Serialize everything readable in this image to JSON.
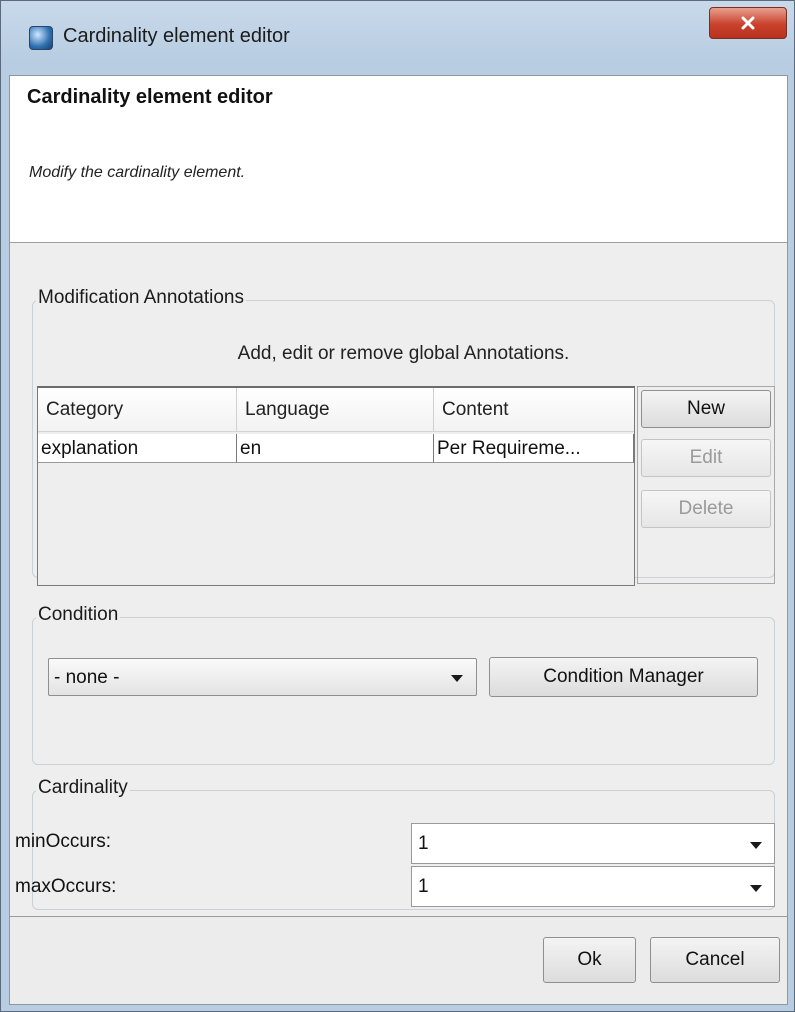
{
  "window": {
    "title": "Cardinality element editor",
    "icon": "globe-icon",
    "close_icon": "close-icon",
    "close_color": "#c9412b"
  },
  "header": {
    "title": "Cardinality element editor",
    "description": "Modify the cardinality element."
  },
  "annotations": {
    "legend": "Modification Annotations",
    "hint": "Add, edit or remove global Annotations.",
    "columns": [
      "Category",
      "Language",
      "Content"
    ],
    "rows": [
      [
        "explanation",
        "en",
        "Per Requireme..."
      ]
    ],
    "buttons": {
      "new": "New",
      "edit": "Edit",
      "delete": "Delete"
    }
  },
  "condition": {
    "legend": "Condition",
    "selected": "- none -",
    "manager_button": "Condition Manager"
  },
  "cardinality": {
    "legend": "Cardinality",
    "min_label": "minOccurs:",
    "min_value": "1",
    "max_label": "maxOccurs:",
    "max_value": "1"
  },
  "footer": {
    "ok": "Ok",
    "cancel": "Cancel"
  }
}
